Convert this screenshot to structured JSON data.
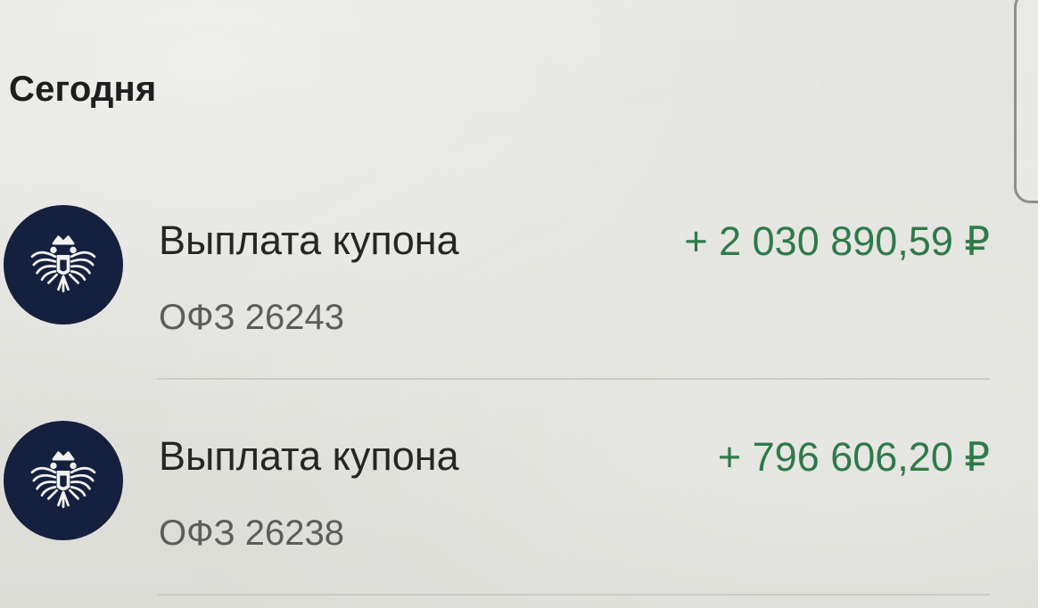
{
  "section": {
    "title": "Сегодня"
  },
  "transactions": [
    {
      "icon": "russian-eagle-emblem-icon",
      "title": "Выплата купона",
      "subtitle": "ОФЗ 26243",
      "amount": "+ 2 030 890,59 ₽"
    },
    {
      "icon": "russian-eagle-emblem-icon",
      "title": "Выплата купона",
      "subtitle": "ОФЗ 26238",
      "amount": "+ 796 606,20 ₽"
    }
  ],
  "colors": {
    "background": "#e3e3df",
    "avatar_bg": "#14203d",
    "income_green": "#2f7a4a",
    "title_text": "#262626",
    "subtitle_text": "#5c5c5c"
  }
}
